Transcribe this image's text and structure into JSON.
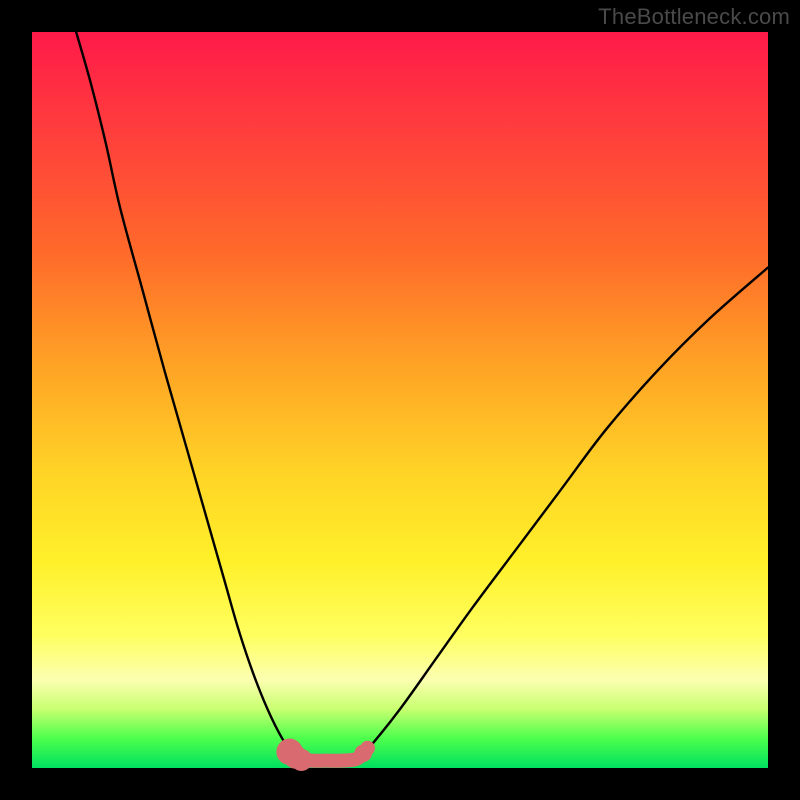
{
  "watermark": "TheBottleneck.com",
  "chart_data": {
    "type": "line",
    "title": "",
    "xlabel": "",
    "ylabel": "",
    "xlim": [
      0,
      100
    ],
    "ylim": [
      0,
      100
    ],
    "series": [
      {
        "name": "left-curve",
        "x": [
          6,
          8,
          10,
          12,
          15,
          18,
          22,
          26,
          28,
          30,
          32,
          34,
          35.5,
          36.5
        ],
        "y": [
          100,
          93,
          85,
          76,
          65,
          54,
          40,
          26,
          19,
          13,
          8,
          4,
          2,
          1
        ]
      },
      {
        "name": "right-curve",
        "x": [
          44,
          46,
          50,
          55,
          60,
          66,
          72,
          78,
          85,
          92,
          100
        ],
        "y": [
          1,
          3,
          8,
          15,
          22,
          30,
          38,
          46,
          54,
          61,
          68
        ]
      },
      {
        "name": "floor-band",
        "x": [
          35,
          36,
          38,
          40,
          42,
          44,
          45,
          45.5
        ],
        "y": [
          2.2,
          1.3,
          1.0,
          1.0,
          1.0,
          1.2,
          2.0,
          2.6
        ]
      }
    ],
    "markers": [
      {
        "series": "floor-band",
        "x": 35.0,
        "y": 2.2,
        "r": 1.8
      },
      {
        "series": "floor-band",
        "x": 35.8,
        "y": 1.5,
        "r": 1.6
      },
      {
        "series": "floor-band",
        "x": 36.6,
        "y": 1.1,
        "r": 1.5
      },
      {
        "series": "floor-band",
        "x": 45.0,
        "y": 2.0,
        "r": 1.2
      },
      {
        "series": "floor-band",
        "x": 45.6,
        "y": 2.7,
        "r": 1.0
      }
    ],
    "colors": {
      "curve": "#000000",
      "floor_band": "#d96a6f",
      "gradient_top": "#ff1a49",
      "gradient_bottom": "#00e060"
    }
  }
}
